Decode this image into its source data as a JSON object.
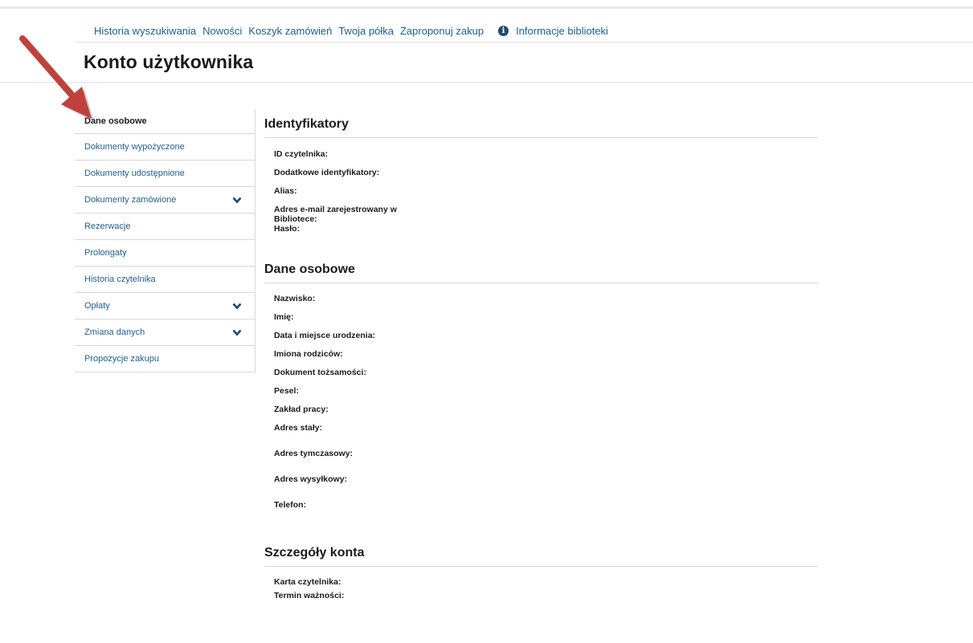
{
  "topnav": {
    "links": [
      "Historia wyszukiwania",
      "Nowości",
      "Koszyk zamówień",
      "Twoja półka",
      "Zaproponuj zakup"
    ],
    "info_label": "Informacje biblioteki",
    "info_icon": "info-circle-icon"
  },
  "page": {
    "title": "Konto użytkownika"
  },
  "sidebar": {
    "items": [
      {
        "label": "Dane osobowe",
        "active": true,
        "expandable": false
      },
      {
        "label": "Dokumenty wypożyczone",
        "active": false,
        "expandable": false
      },
      {
        "label": "Dokumenty udostępnione",
        "active": false,
        "expandable": false
      },
      {
        "label": "Dokumenty zamówione",
        "active": false,
        "expandable": true
      },
      {
        "label": "Rezerwacje",
        "active": false,
        "expandable": false
      },
      {
        "label": "Prolongaty",
        "active": false,
        "expandable": false
      },
      {
        "label": "Historia czytelnika",
        "active": false,
        "expandable": false
      },
      {
        "label": "Opłaty",
        "active": false,
        "expandable": true
      },
      {
        "label": "Zmiana danych",
        "active": false,
        "expandable": true
      },
      {
        "label": "Propozycje zakupu",
        "active": false,
        "expandable": false
      }
    ]
  },
  "sections": [
    {
      "title": "Identyfikatory",
      "fields": [
        "ID czytelnika:",
        "Dodatkowe identyfikatory:",
        "Alias:",
        "Adres e-mail zarejestrowany w",
        "Bibliotece:",
        "Hasło:"
      ]
    },
    {
      "title": "Dane osobowe",
      "fields": [
        "Nazwisko:",
        "Imię:",
        "Data i miejsce urodzenia:",
        "Imiona rodziców:",
        "Dokument tożsamości:",
        "Pesel:",
        "Zakład pracy:",
        "Adres stały:",
        "Adres tymczasowy:",
        "Adres wysyłkowy:",
        "Telefon:"
      ]
    },
    {
      "title": "Szczegóły konta",
      "fields": [
        "Karta czytelnika:",
        "Termin ważności:"
      ]
    }
  ],
  "colors": {
    "link": "#1f5f8b",
    "annotation_arrow": "#c0413b",
    "chevron": "#1d4a6e"
  }
}
